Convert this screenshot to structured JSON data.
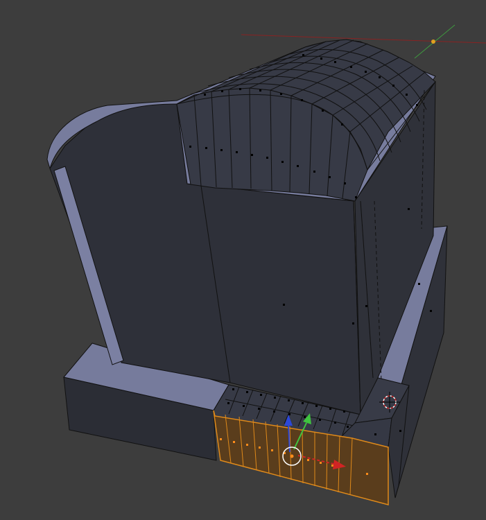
{
  "viewport": {
    "background": "#3d3d3d",
    "object_color": "#7f84a6",
    "face_dark": "#2e3039",
    "face_mid": "#3a3d4a",
    "edge_color": "#111111",
    "vertex_color": "#000000",
    "selection_color": "#e08a1a",
    "selected_face_fill": "#5a3d1c"
  },
  "icons": {
    "cursor": "3d-cursor-icon",
    "gizmo_x": "x-axis-arrow-icon",
    "gizmo_y": "y-axis-arrow-icon",
    "gizmo_z": "z-axis-arrow-icon",
    "pivot": "pivot-circle-icon"
  },
  "axis_colors": {
    "x": "#d12424",
    "y": "#3fc43f",
    "z": "#2c48d8"
  }
}
